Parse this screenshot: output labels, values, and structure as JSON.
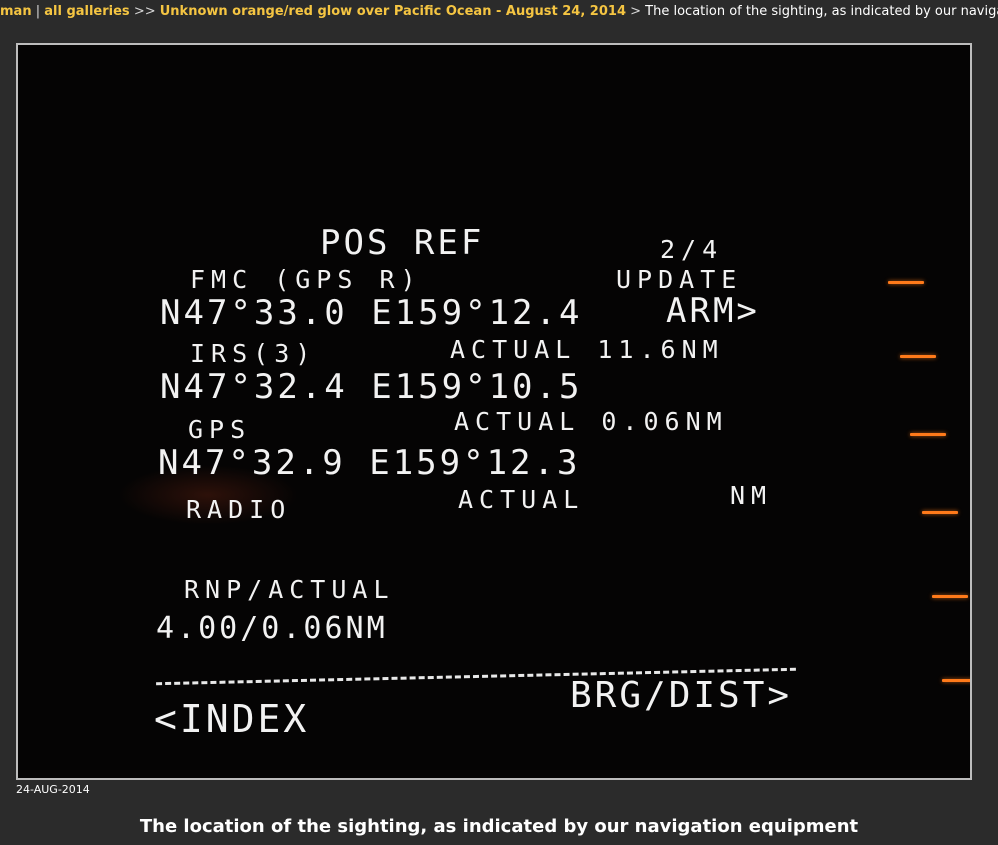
{
  "breadcrumb": {
    "owner": "man",
    "separator1": " | ",
    "all_galleries": "all galleries",
    "separator2": " >> ",
    "gallery": "Unknown orange/red glow over Pacific Ocean - August 24, 2014",
    "separator3": " > ",
    "current": "The location of the sighting, as indicated by our navigation equipment"
  },
  "photo": {
    "cdu_screen": {
      "title": "POS REF",
      "page": "2/4",
      "fmc_label": "FMC (GPS R)",
      "update_label": "UPDATE",
      "fmc_pos": "N47°33.0 E159°12.4",
      "arm": "ARM>",
      "irs_label": "IRS(3)",
      "irs_actual": "ACTUAL 11.6NM",
      "irs_pos": "N47°32.4 E159°10.5",
      "gps_label": "GPS",
      "gps_actual": "ACTUAL 0.06NM",
      "gps_pos": "N47°32.9 E159°12.3",
      "radio_label": "RADIO",
      "radio_actual": "ACTUAL",
      "radio_nm": "NM",
      "rnp_label": "RNP/ACTUAL",
      "rnp_value": "4.00/0.06NM",
      "index": "<INDEX",
      "brg_dist": "BRG/DIST>"
    },
    "lsk_color": "#ff7a1a"
  },
  "date": "24-AUG-2014",
  "caption": "The location of the sighting, as indicated by our navigation equipment"
}
